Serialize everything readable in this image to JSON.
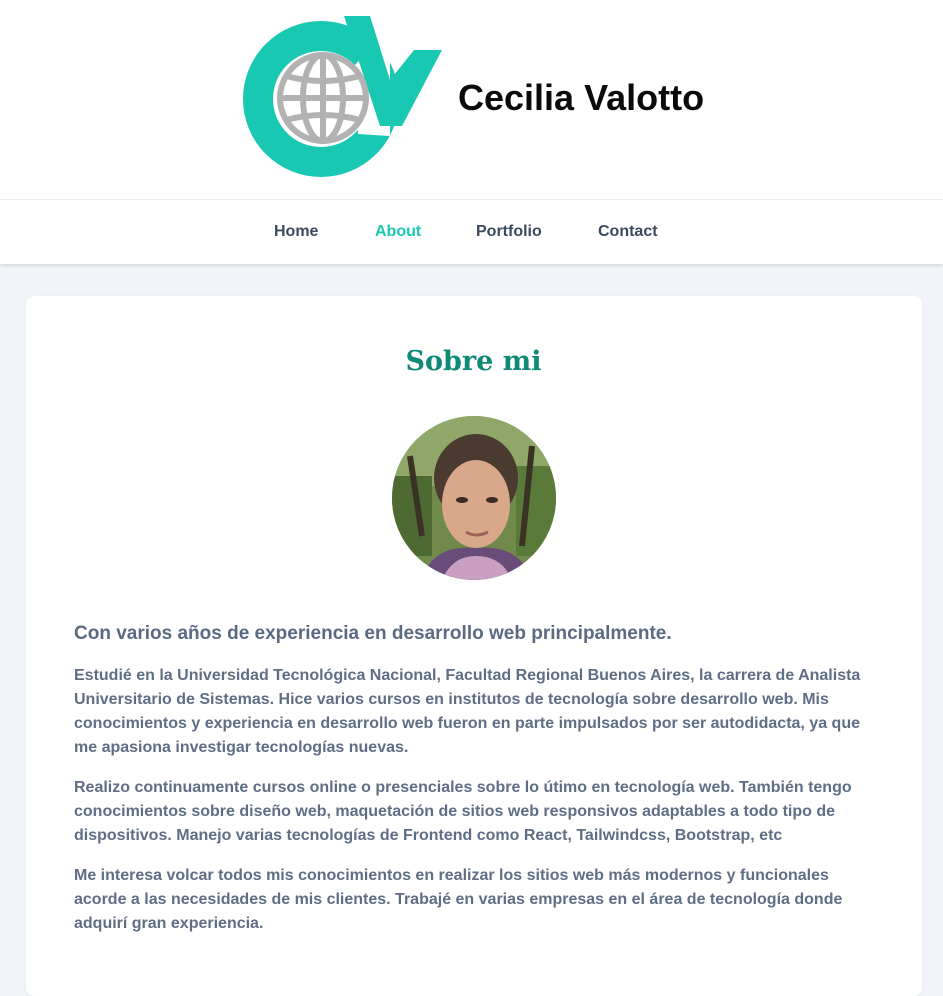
{
  "header": {
    "site_name": "Cecilia Valotto",
    "logo_icon": "cv-globe-logo-icon",
    "brand_color": "#19c8b3",
    "globe_color": "#b2b2b2"
  },
  "nav": {
    "items": [
      {
        "label": "Home",
        "active": false
      },
      {
        "label": "About",
        "active": true
      },
      {
        "label": "Portfolio",
        "active": false
      },
      {
        "label": "Contact",
        "active": false
      }
    ],
    "active_color": "#19c8b3"
  },
  "about": {
    "title": "Sobre mi",
    "lead": "Con varios años de experiencia en desarrollo web principalmente.",
    "paragraphs": [
      "Estudié en la Universidad Tecnológica Nacional, Facultad Regional Buenos Aires, la carrera de Analista Universitario de Sistemas. Hice varios cursos en institutos de tecnología sobre desarrollo web. Mis conocimientos y experiencia en desarrollo web fueron en parte impulsados por ser autodidacta, ya que me apasiona investigar tecnologías nuevas.",
      "Realizo continuamente cursos online o presenciales sobre lo útimo en tecnología web. También tengo conocimientos sobre diseño web, maquetación de sitios web responsivos adaptables a todo tipo de dispositivos. Manejo varias tecnologías de Frontend como React, Tailwindcss, Bootstrap, etc",
      "Me interesa volcar todos mis conocimientos en realizar los sitios web más modernos y funcionales acorde a las necesidades de mis clientes. Trabajé en varias empresas en el área de tecnología donde adquirí gran experiencia."
    ]
  }
}
